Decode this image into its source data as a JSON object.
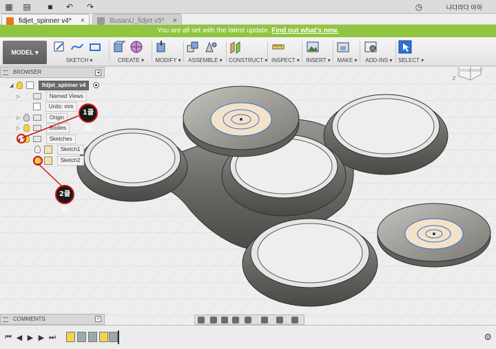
{
  "titlebar": {
    "tabs": [
      {
        "label": "fidjet_spinner v4*",
        "active": true
      },
      {
        "label": "BusanU_fidjet v5*",
        "active": false
      }
    ],
    "user": "나다라다 아하",
    "close_glyph": "×",
    "dropdown_glyph": "▾"
  },
  "banner": {
    "message": "You are all set with the latest update.",
    "link": "Find out what's new."
  },
  "toolbar": {
    "workspace": "MODEL",
    "groups": [
      "SKETCH",
      "CREATE",
      "MODIFY",
      "ASSEMBLE",
      "CONSTRUCT",
      "INSPECT",
      "INSERT",
      "MAKE",
      "ADD-INS",
      "SELECT"
    ]
  },
  "viewcube": {
    "face_right": "RIGHT",
    "face_front": "FRONT",
    "axis_x": "X",
    "axis_z": "Z"
  },
  "browser": {
    "title": "BROWSER",
    "root": "fidjet_spinner v4",
    "items": {
      "named_views": "Named Views",
      "units": "Units: mm",
      "origin": "Origin",
      "bodies": "Bodies",
      "sketches": "Sketches",
      "sketch1": "Sketch1",
      "sketch2": "Sketch2"
    }
  },
  "annotations": {
    "step1": "1클릭",
    "step2": "2클릭"
  },
  "comments": {
    "title": "COMMENTS"
  },
  "colors": {
    "banner": "#8fc53f",
    "callout_ring": "#d01515",
    "accent_blue": "#2f6fd6",
    "model_gray": "#6b6a66"
  }
}
